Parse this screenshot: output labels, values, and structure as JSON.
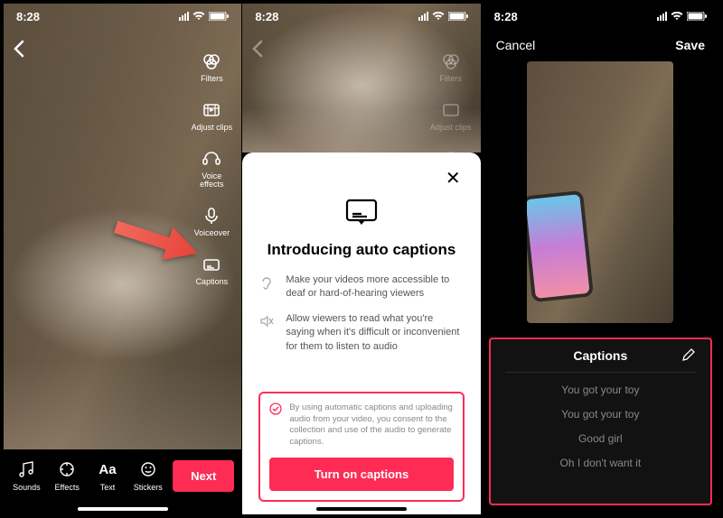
{
  "status": {
    "time": "8:28"
  },
  "phone1": {
    "tools": {
      "filters": "Filters",
      "adjust": "Adjust clips",
      "voice_effects": "Voice\neffects",
      "voiceover": "Voiceover",
      "captions": "Captions"
    },
    "bottom": {
      "sounds": "Sounds",
      "effects": "Effects",
      "text": "Text",
      "stickers": "Stickers",
      "next": "Next"
    }
  },
  "phone2": {
    "modal": {
      "title": "Introducing auto captions",
      "bullet1": "Make your videos more accessible to deaf or hard-of-hearing viewers",
      "bullet2": "Allow viewers to read what you're saying when it's difficult or inconvenient for them to listen to audio",
      "consent": "By using automatic captions and uploading audio from your video, you consent to the collection and use of the audio to generate captions.",
      "cta": "Turn on captions"
    }
  },
  "phone3": {
    "cancel": "Cancel",
    "save": "Save",
    "captions_header": "Captions",
    "lines": [
      "You got your toy",
      "You got your toy",
      "Good girl",
      "Oh I don't want it"
    ]
  }
}
